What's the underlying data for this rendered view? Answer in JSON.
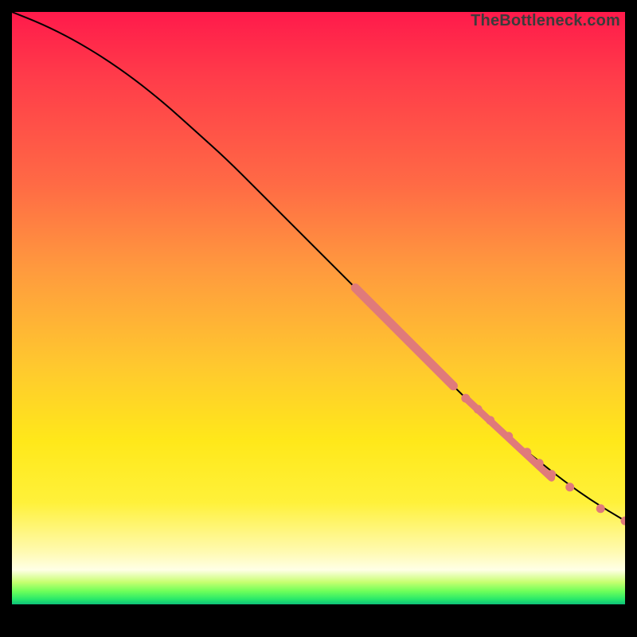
{
  "watermark": "TheBottleneck.com",
  "chart_data": {
    "type": "line",
    "title": "",
    "xlabel": "",
    "ylabel": "",
    "xlim": [
      0,
      100
    ],
    "ylim": [
      0,
      100
    ],
    "grid": false,
    "series": [
      {
        "name": "curve",
        "x": [
          0,
          5,
          10,
          15,
          20,
          25,
          30,
          35,
          40,
          45,
          50,
          55,
          60,
          65,
          70,
          75,
          80,
          85,
          90,
          95,
          100
        ],
        "y": [
          100,
          98,
          95.5,
          92.5,
          89,
          85,
          80.5,
          76,
          71,
          66,
          61,
          56,
          51,
          46,
          41,
          36,
          31.5,
          27.5,
          23.5,
          20,
          17
        ]
      }
    ],
    "markers": [
      {
        "segment": "dense",
        "x_start": 56,
        "x_end": 72,
        "y_start": 55,
        "y_end": 39
      },
      {
        "segment": "sparse",
        "x_start": 74,
        "x_end": 88,
        "y_start": 37,
        "y_end": 24,
        "points_x": [
          74,
          76,
          78,
          81,
          84,
          86,
          88
        ],
        "points_y": [
          37,
          35.2,
          33.4,
          30.8,
          28.2,
          26.4,
          24.6
        ]
      },
      {
        "segment": "tail",
        "points_x": [
          91,
          96,
          100
        ],
        "points_y": [
          22.5,
          19,
          17
        ]
      }
    ],
    "marker_color": "#e07a7a",
    "line_color": "#000000"
  }
}
